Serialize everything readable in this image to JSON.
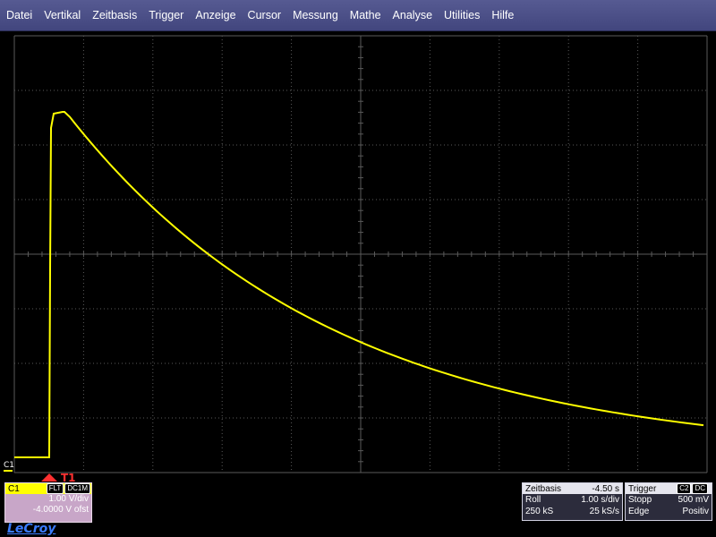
{
  "menu": [
    "Datei",
    "Vertikal",
    "Zeitbasis",
    "Trigger",
    "Anzeige",
    "Cursor",
    "Messung",
    "Mathe",
    "Analyse",
    "Utilities",
    "Hilfe"
  ],
  "channel_marker": "C1",
  "trigger_marker": "T1",
  "channel": {
    "name": "C1",
    "badge1": "FLT",
    "badge2": "DC1M",
    "scale": "1.00 V/div",
    "offset": "-4.0000 V ofst"
  },
  "timebase": {
    "title": "Zeitbasis",
    "delay": "-4.50 s",
    "mode": "Roll",
    "rate": "1.00 s/div",
    "samples": "250 kS",
    "srate": "25 kS/s"
  },
  "trigger": {
    "title": "Trigger",
    "badge1": "C2",
    "badge2": "DC",
    "state": "Stopp",
    "level": "500 mV",
    "type": "Edge",
    "slope": "Positiv"
  },
  "brand": "LeCroy",
  "colors": {
    "trace": "#ffff00",
    "grid": "#5a5a5a",
    "menu": "#4a4e88",
    "trigger": "#ff3030"
  }
}
